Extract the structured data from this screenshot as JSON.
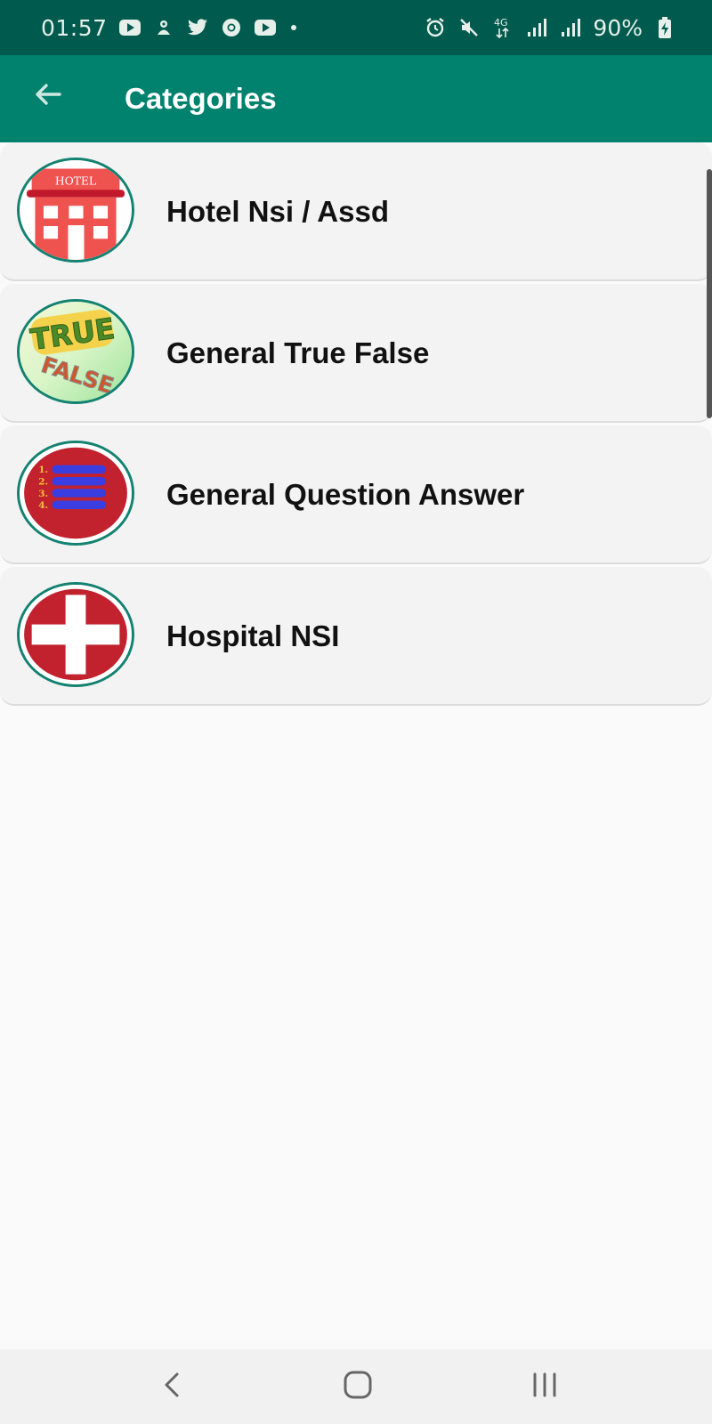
{
  "status_bar": {
    "time": "01:57",
    "network": "4G",
    "battery_percent": "90%",
    "left_icons": [
      "youtube-icon",
      "notification-app-icon",
      "twitter-icon",
      "chrome-icon",
      "youtube-icon",
      "more-dot-icon"
    ],
    "right_icons": [
      "alarm-icon",
      "mute-icon",
      "network-4g-icon",
      "signal-icon",
      "signal-icon",
      "battery-charging-icon"
    ]
  },
  "app_bar": {
    "title": "Categories",
    "back_icon": "arrow-back-icon"
  },
  "categories": [
    {
      "label": "Hotel Nsi / Assd",
      "icon": "hotel-icon",
      "icon_text": "HOTEL"
    },
    {
      "label": "General True False",
      "icon": "true-false-icon",
      "icon_text_top": "TRUE",
      "icon_text_bottom": "FALSE"
    },
    {
      "label": "General Question Answer",
      "icon": "numbered-list-icon",
      "icon_numbers": [
        "1.",
        "2.",
        "3.",
        "4."
      ]
    },
    {
      "label": "Hospital NSI",
      "icon": "hospital-cross-icon"
    }
  ],
  "nav_bar": {
    "items": [
      "back-nav-icon",
      "home-nav-icon",
      "recents-nav-icon"
    ]
  },
  "colors": {
    "status_bar": "#005b4e",
    "app_bar": "#00826f",
    "avatar_border": "#148271",
    "card_bg": "#f3f3f3",
    "page_bg": "#fafafa"
  }
}
